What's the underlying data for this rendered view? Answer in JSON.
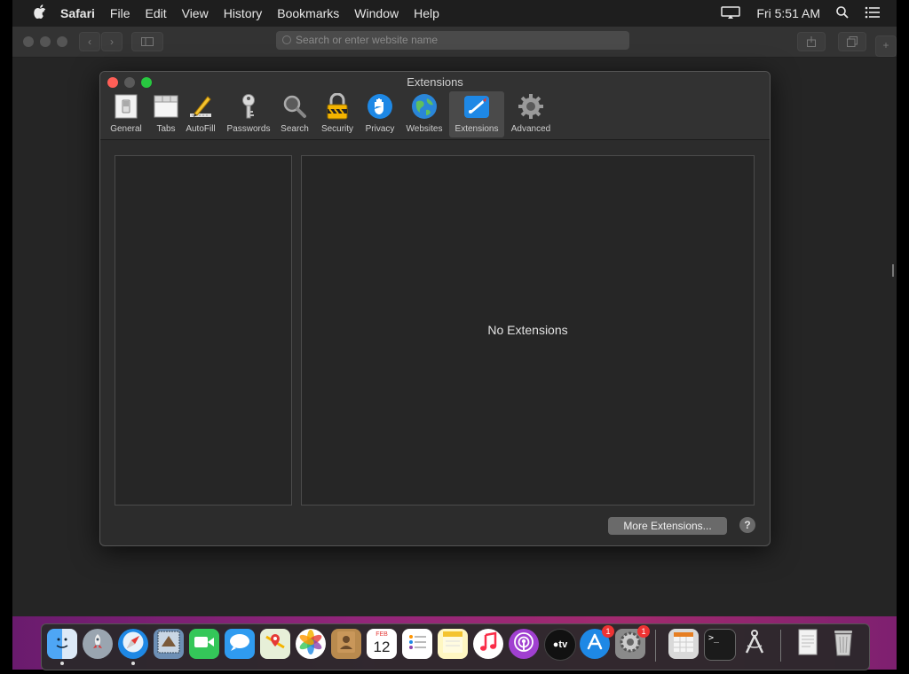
{
  "menubar": {
    "apple": "",
    "app": "Safari",
    "items": [
      "File",
      "Edit",
      "View",
      "History",
      "Bookmarks",
      "Window",
      "Help"
    ],
    "clock": "Fri 5:51 AM"
  },
  "browser": {
    "address_placeholder": "Search or enter website name"
  },
  "prefs": {
    "title": "Extensions",
    "tabs": [
      {
        "label": "General",
        "icon": "general-switch-icon"
      },
      {
        "label": "Tabs",
        "icon": "tabs-icon"
      },
      {
        "label": "AutoFill",
        "icon": "autofill-pencil-icon"
      },
      {
        "label": "Passwords",
        "icon": "key-icon"
      },
      {
        "label": "Search",
        "icon": "magnifier-icon"
      },
      {
        "label": "Security",
        "icon": "lock-icon"
      },
      {
        "label": "Privacy",
        "icon": "hand-icon"
      },
      {
        "label": "Websites",
        "icon": "globe-icon"
      },
      {
        "label": "Extensions",
        "icon": "extensions-icon"
      },
      {
        "label": "Advanced",
        "icon": "gear-icon"
      }
    ],
    "active_tab": "Extensions",
    "empty_message": "No Extensions",
    "more_button": "More Extensions...",
    "help_button": "?"
  },
  "dock": {
    "badges": {
      "app_store": "1",
      "system_prefs": "1"
    },
    "calendar_day": "12",
    "calendar_month": "FEB"
  },
  "colors": {
    "close": "#ff5f57",
    "minimize": "#febc2e",
    "zoom": "#28c840",
    "accent": "#1e88e5"
  }
}
